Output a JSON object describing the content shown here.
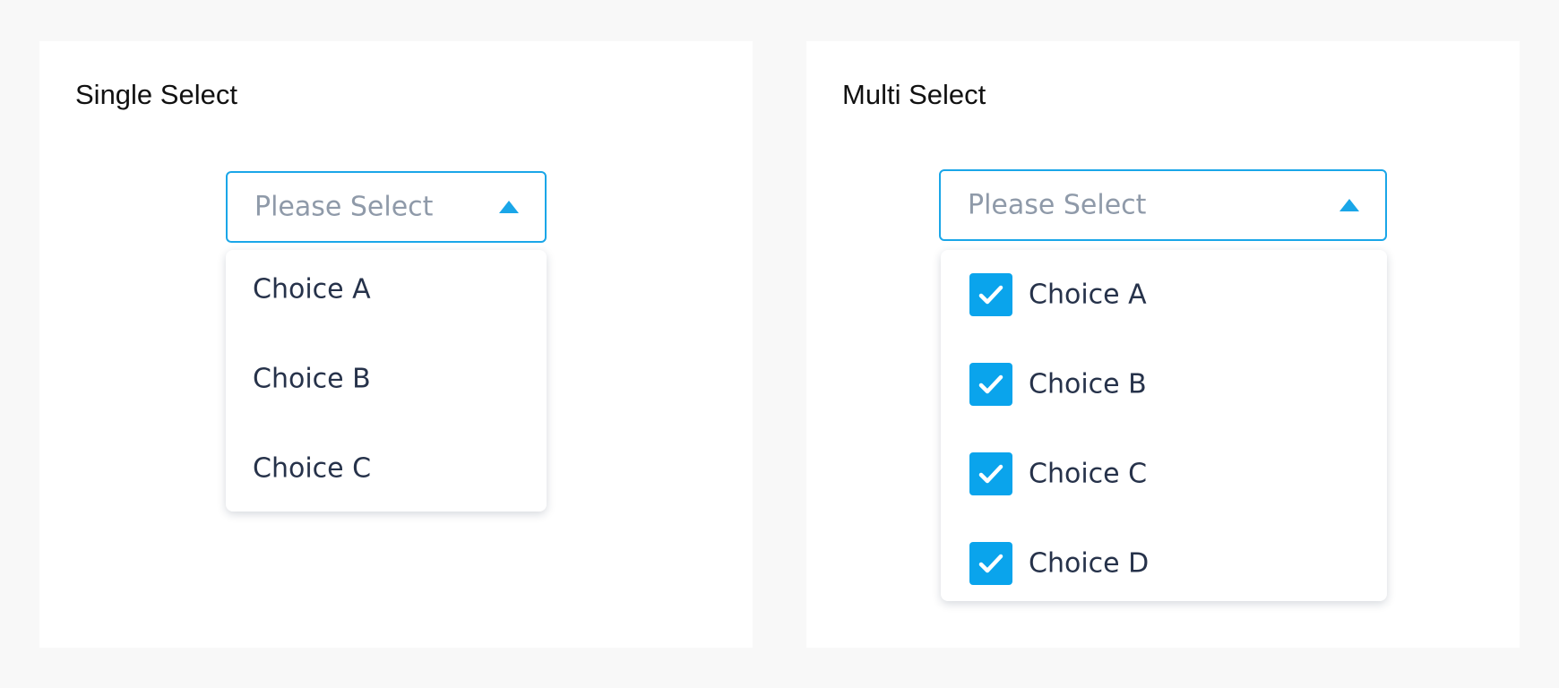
{
  "accent_color": "#1aa6e8",
  "checkbox_color": "#0aa4ec",
  "single_select": {
    "title": "Single Select",
    "placeholder": "Please Select",
    "arrow_icon": "triangle-up-icon",
    "options": [
      {
        "label": "Choice A"
      },
      {
        "label": "Choice B"
      },
      {
        "label": "Choice C"
      }
    ]
  },
  "multi_select": {
    "title": "Multi Select",
    "placeholder": "Please Select",
    "arrow_icon": "triangle-up-icon",
    "options": [
      {
        "label": "Choice A",
        "checked": true
      },
      {
        "label": "Choice B",
        "checked": true
      },
      {
        "label": "Choice C",
        "checked": true
      },
      {
        "label": "Choice D",
        "checked": true
      }
    ]
  }
}
